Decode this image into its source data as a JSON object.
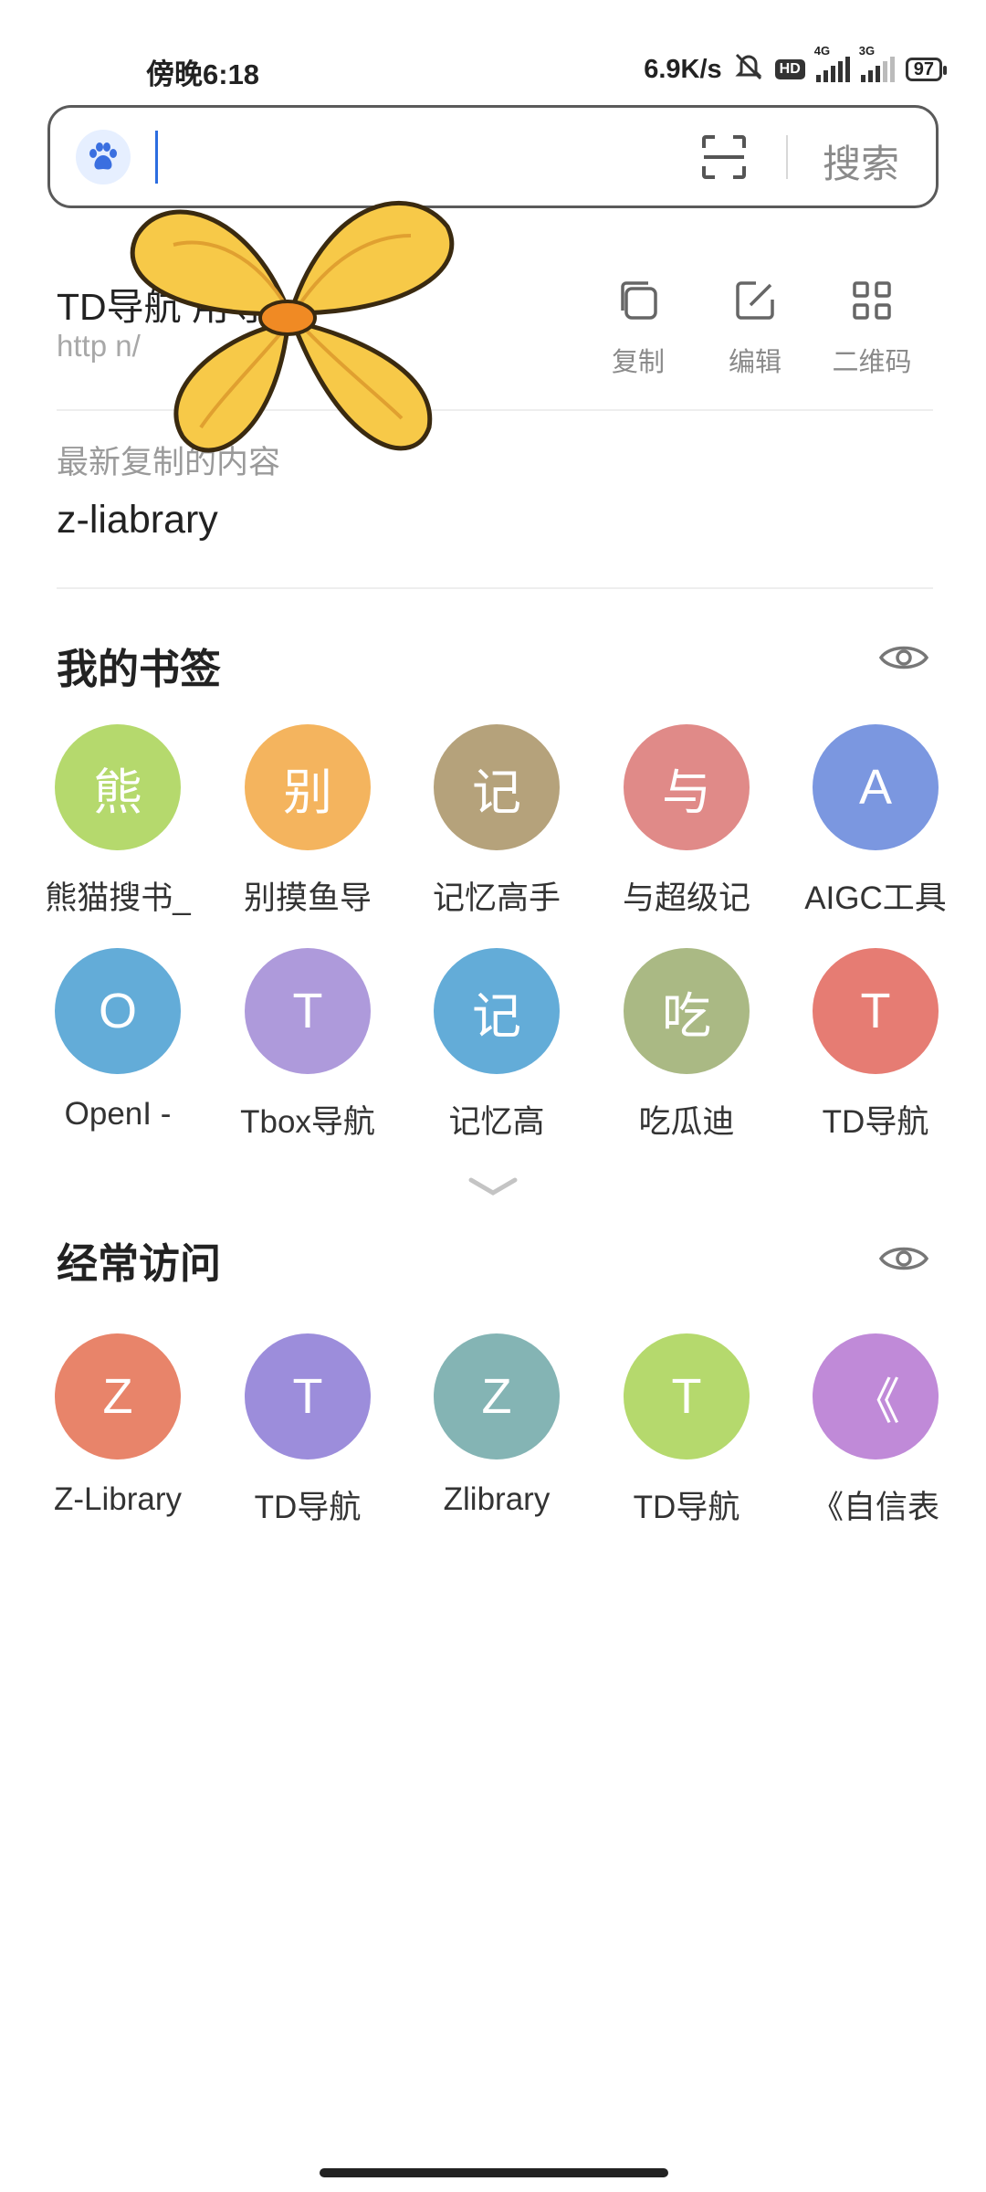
{
  "status_bar": {
    "time": "傍晚6:18",
    "net_speed": "6.9K/s",
    "hd_badge": "HD",
    "sim1_label": "4G",
    "sim2_label": "3G",
    "battery": "97"
  },
  "search": {
    "placeholder": "",
    "button_label": "搜索"
  },
  "clipboard": {
    "title": "TD导航                 用导…",
    "url": "http                                   n/",
    "actions": [
      {
        "label": "复制",
        "icon": "copy-icon"
      },
      {
        "label": "编辑",
        "icon": "edit-icon"
      },
      {
        "label": "二维码",
        "icon": "qrcode-icon"
      }
    ],
    "recent_label": "最新复制的内容",
    "recent_value": "z-liabrary"
  },
  "bookmarks": {
    "title": "我的书签",
    "items": [
      {
        "letter": "熊",
        "name": "熊猫搜书_",
        "color": "#b5d96d"
      },
      {
        "letter": "别",
        "name": "别摸鱼导",
        "color": "#f4b45e"
      },
      {
        "letter": "记",
        "name": "记忆高手",
        "color": "#b5a27b"
      },
      {
        "letter": "与",
        "name": "与超级记",
        "color": "#e08a88"
      },
      {
        "letter": "A",
        "name": "AIGC工具",
        "color": "#7b97e0"
      },
      {
        "letter": "O",
        "name": "OpenI -",
        "color": "#63acd8"
      },
      {
        "letter": "T",
        "name": "Tbox导航",
        "color": "#ae9adb"
      },
      {
        "letter": "记",
        "name": "记忆高",
        "color": "#63acd8"
      },
      {
        "letter": "吃",
        "name": "吃瓜迪",
        "color": "#aab984"
      },
      {
        "letter": "T",
        "name": "TD导航",
        "color": "#e67c73"
      }
    ]
  },
  "frequent": {
    "title": "经常访问",
    "items": [
      {
        "letter": "Z",
        "name": "Z-Library",
        "color": "#e8846a"
      },
      {
        "letter": "T",
        "name": "TD导航",
        "color": "#9c8ddb"
      },
      {
        "letter": "Z",
        "name": "Zlibrary",
        "color": "#84b4b4"
      },
      {
        "letter": "T",
        "name": "TD导航",
        "color": "#b5d96d"
      },
      {
        "letter": "《",
        "name": "《自信表",
        "color": "#c08ad8"
      }
    ]
  }
}
